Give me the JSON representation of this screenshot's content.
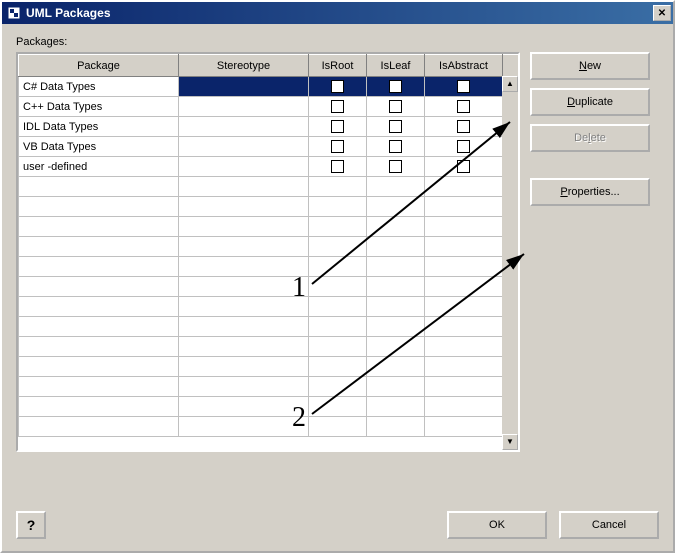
{
  "window": {
    "title": "UML Packages"
  },
  "label": "Packages:",
  "columns": {
    "package": "Package",
    "stereotype": "Stereotype",
    "isroot": "IsRoot",
    "isleaf": "IsLeaf",
    "isabstract": "IsAbstract"
  },
  "rows": [
    {
      "package": "C# Data Types",
      "stereotype": "",
      "selected": true
    },
    {
      "package": "C++ Data Types",
      "stereotype": "",
      "selected": false
    },
    {
      "package": "IDL Data Types",
      "stereotype": "",
      "selected": false
    },
    {
      "package": "VB Data Types",
      "stereotype": "",
      "selected": false
    },
    {
      "package": "user -defined",
      "stereotype": "",
      "selected": false
    }
  ],
  "buttons": {
    "new": "New",
    "duplicate": "Duplicate",
    "delete": "Delete",
    "properties": "Properties...",
    "ok": "OK",
    "cancel": "Cancel"
  },
  "annotations": {
    "one": "1",
    "two": "2"
  }
}
